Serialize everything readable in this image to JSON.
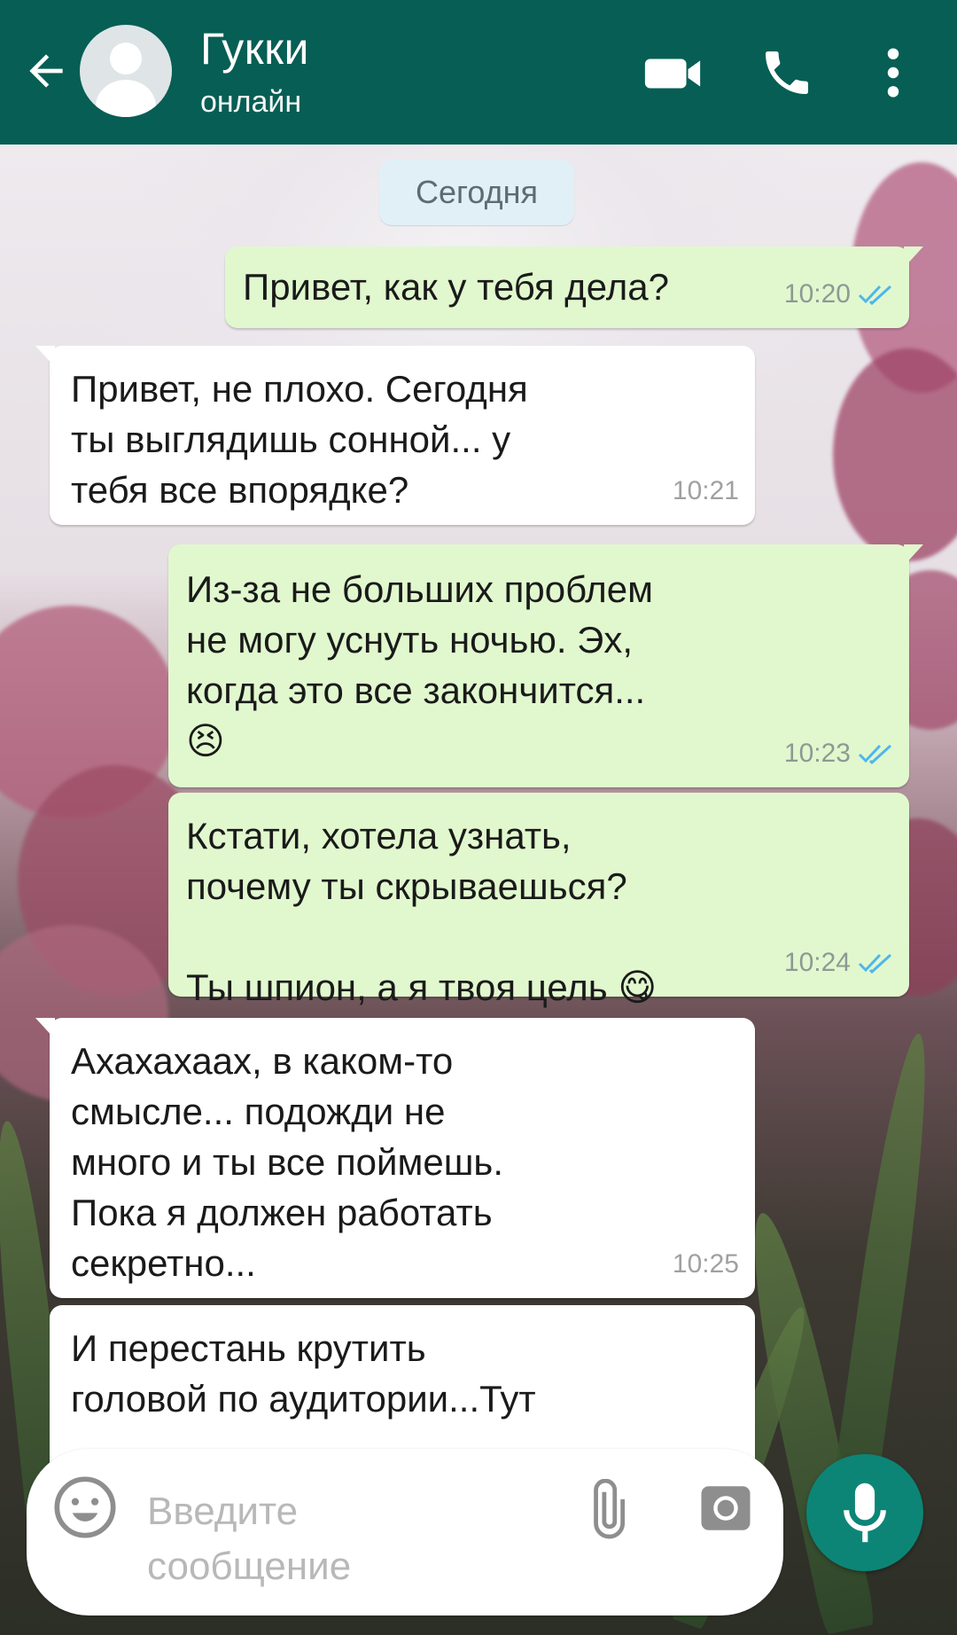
{
  "header": {
    "contact_name": "Гукки",
    "status": "онлайн",
    "icons": [
      "back-arrow-icon",
      "avatar-placeholder",
      "video-call-icon",
      "phone-call-icon",
      "more-vertical-icon"
    ],
    "color": "#075e54"
  },
  "date_chip": "Сегодня",
  "messages": [
    {
      "dir": "out",
      "text": "Привет, как у тебя дела?",
      "time": "10:20",
      "read": true
    },
    {
      "dir": "in",
      "text": "Привет, не плохо. Сегодня\nты выглядишь сонной... у\nтебя все впорядке?",
      "time": "10:21"
    },
    {
      "dir": "out",
      "text": "Из-за не больших проблем\nне могу уснуть ночью. Эх,\nкогда это все закончится...\n😣",
      "time": "10:23",
      "read": true
    },
    {
      "dir": "out",
      "text": "Кстати, хотела узнать,\nпочему ты скрываешься?\n\nТы шпион, а я твоя цель 😋",
      "time": "10:24",
      "read": true
    },
    {
      "dir": "in",
      "text": "Ахахахаах, в каком-то\nсмысле... подожди не\nмного и ты все поймешь.\nПока я должен работать\nсекретно...",
      "time": "10:25"
    },
    {
      "dir": "in",
      "text": "И перестань крутить\nголовой по аудитории...Тут",
      "time": ""
    }
  ],
  "composer": {
    "placeholder": "Введите сообщение",
    "icons": [
      "emoji-icon",
      "attach-icon",
      "camera-icon",
      "mic-icon"
    ],
    "mic_color": "#0c8577"
  },
  "colors": {
    "outgoing_bubble": "#e1f8ce",
    "incoming_bubble": "#ffffff",
    "read_ticks": "#4fb6ec"
  }
}
